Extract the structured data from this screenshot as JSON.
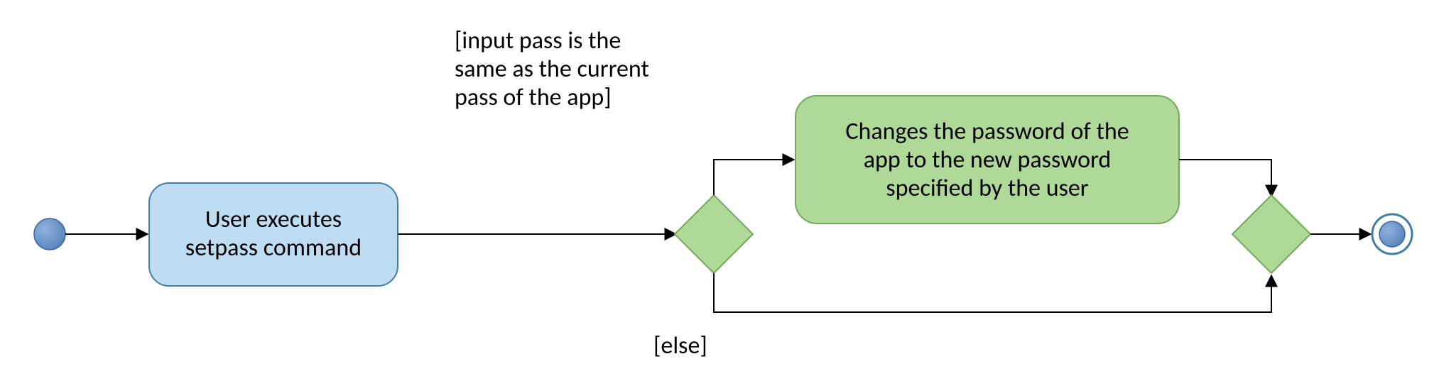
{
  "palette": {
    "blueFill": "#bfddf2",
    "blueStroke": "#3f7eab",
    "greenFill": "#aed999",
    "greenStroke": "#72a858",
    "initialFill": "#6a94c6",
    "initialStroke": "#3f66a0",
    "edgeStroke": "#000000"
  },
  "activity1": {
    "line1": "User executes",
    "line2": "setpass command"
  },
  "activity2": {
    "line1": "Changes the password of the",
    "line2": "app to the new password",
    "line3": "specified by the user"
  },
  "guardTrue": {
    "line1": "[input pass is the",
    "line2": "same as the current",
    "line3": "pass of the app]"
  },
  "guardElse": "[else]",
  "chart_data": {
    "type": "activity-diagram",
    "nodes": [
      {
        "id": "initial",
        "kind": "initial"
      },
      {
        "id": "a1",
        "kind": "action",
        "label": "User executes setpass command"
      },
      {
        "id": "d1",
        "kind": "decision"
      },
      {
        "id": "a2",
        "kind": "action",
        "label": "Changes the password of the app to the new password specified by the user"
      },
      {
        "id": "m1",
        "kind": "merge"
      },
      {
        "id": "final",
        "kind": "final"
      }
    ],
    "edges": [
      {
        "from": "initial",
        "to": "a1"
      },
      {
        "from": "a1",
        "to": "d1"
      },
      {
        "from": "d1",
        "to": "a2",
        "guard": "[input pass is the same as the current pass of the app]"
      },
      {
        "from": "d1",
        "to": "m1",
        "guard": "[else]"
      },
      {
        "from": "a2",
        "to": "m1"
      },
      {
        "from": "m1",
        "to": "final"
      }
    ]
  }
}
